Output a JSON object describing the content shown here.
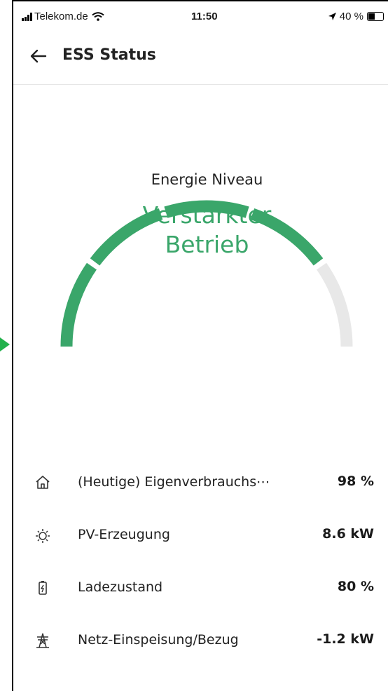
{
  "status_bar": {
    "carrier": "Telekom.de",
    "time": "11:50",
    "battery": "40 %"
  },
  "header": {
    "title": "ESS Status"
  },
  "gauge": {
    "label": "Energie Niveau",
    "value_line1": "Verstärkter",
    "value_line2": "Betrieb",
    "level_segments_filled": 4,
    "level_segments_total": 5,
    "color_active": "#3aa66a",
    "color_inactive": "#e8e8e8"
  },
  "stats": [
    {
      "icon": "house-icon",
      "label": "(Heutige) Eigenverbrauchs⋯",
      "value": "98 %"
    },
    {
      "icon": "sun-icon",
      "label": "PV-Erzeugung",
      "value": "8.6 kW"
    },
    {
      "icon": "battery-icon",
      "label": "Ladezustand",
      "value": "80 %"
    },
    {
      "icon": "power-tower-icon",
      "label": "Netz-Einspeisung/Bezug",
      "value": "-1.2 kW"
    }
  ]
}
